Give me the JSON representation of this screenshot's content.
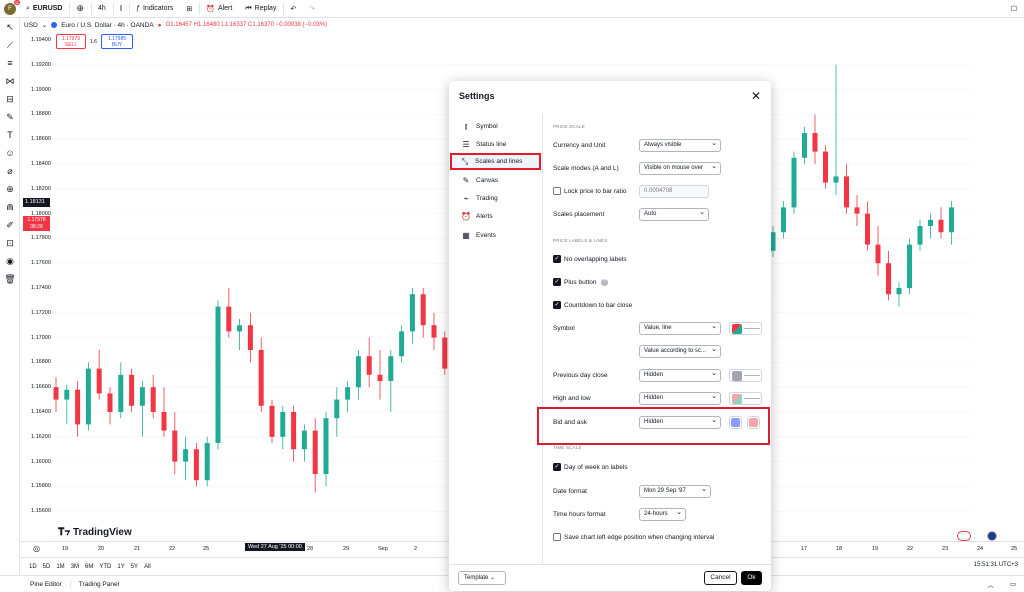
{
  "topbar": {
    "logo_letter": "F",
    "logo_badge": "11",
    "symbol": "EURUSD",
    "add_label": "+",
    "interval": "4h",
    "indicators": "Indicators",
    "alert": "Alert",
    "replay": "Replay"
  },
  "symbol_bar": {
    "currency": "USD",
    "title": "Euro / U.S. Dollar · 4h · OANDA",
    "ohlc": "O1.16457 H1.16480 L1.16337 C1.16370 −0.00038 (−0.03%)",
    "sell_price": "1.17979",
    "sell_label": "SELL",
    "spread": "1.6",
    "buy_price": "1.17985",
    "buy_label": "BUY"
  },
  "yaxis": {
    "labels": [
      "1.19400",
      "1.19200",
      "1.19000",
      "1.18800",
      "1.18600",
      "1.18400",
      "1.18200",
      "1.18000",
      "1.17800",
      "1.17600",
      "1.17400",
      "1.17200",
      "1.17000",
      "1.16800",
      "1.16600",
      "1.16400",
      "1.16200",
      "1.16000",
      "1.15800",
      "1.15600"
    ],
    "tag_black": "1.18131",
    "tag_red_price": "1.17978",
    "tag_red_time": "08:28"
  },
  "xaxis": {
    "labels_left": [
      "19",
      "20",
      "21",
      "22",
      "25",
      "28",
      "29",
      "Sep",
      "2"
    ],
    "highlight": "Wed 27 Aug '25   00:00",
    "labels_right": [
      "17",
      "18",
      "19",
      "22",
      "23",
      "24",
      "25"
    ]
  },
  "timeframes": [
    "1D",
    "5D",
    "1M",
    "3M",
    "6M",
    "YTD",
    "1Y",
    "5Y",
    "All"
  ],
  "clock": "15:51:31 UTC+3",
  "bottom_tabs": [
    "Pine Editor",
    "Trading Panel"
  ],
  "watermark": "TradingView",
  "dialog": {
    "title": "Settings",
    "nav": [
      {
        "label": "Symbol",
        "icon": "candle-icon"
      },
      {
        "label": "Status line",
        "icon": "status-line-icon"
      },
      {
        "label": "Scales and lines",
        "icon": "scales-icon"
      },
      {
        "label": "Canvas",
        "icon": "canvas-icon"
      },
      {
        "label": "Trading",
        "icon": "trading-icon"
      },
      {
        "label": "Alerts",
        "icon": "alarm-icon"
      },
      {
        "label": "Events",
        "icon": "calendar-icon"
      }
    ],
    "price_scale_title": "PRICE SCALE",
    "currency_unit_label": "Currency and Unit",
    "currency_unit_value": "Always visible",
    "scale_modes_label": "Scale modes (A and L)",
    "scale_modes_value": "Visible on mouse over",
    "lock_ratio_label": "Lock price to bar ratio",
    "lock_ratio_value": "0.0004708",
    "scales_placement_label": "Scales placement",
    "scales_placement_value": "Auto",
    "price_labels_title": "PRICE LABELS & LINES",
    "no_overlap_label": "No overlapping labels",
    "plus_button_label": "Plus button",
    "countdown_label": "Countdown to bar close",
    "symbol_label": "Symbol",
    "symbol_value": "Value, line",
    "symbol_value2": "Value according to sc...",
    "prev_day_label": "Previous day close",
    "prev_day_value": "Hidden",
    "high_low_label": "High and low",
    "high_low_value": "Hidden",
    "bid_ask_label": "Bid and ask",
    "bid_ask_value": "Hidden",
    "time_scale_title": "TIME SCALE",
    "day_of_week_label": "Day of week on labels",
    "date_format_label": "Date format",
    "date_format_value": "Mon 29 Sep '97",
    "time_hours_label": "Time hours format",
    "time_hours_value": "24-hours",
    "save_left_edge_label": "Save chart left edge position when changing interval",
    "template_label": "Template",
    "cancel_label": "Cancel",
    "ok_label": "Ok"
  },
  "colors": {
    "up": "#22ab94",
    "down": "#f23645",
    "highlight": "#d62031"
  }
}
